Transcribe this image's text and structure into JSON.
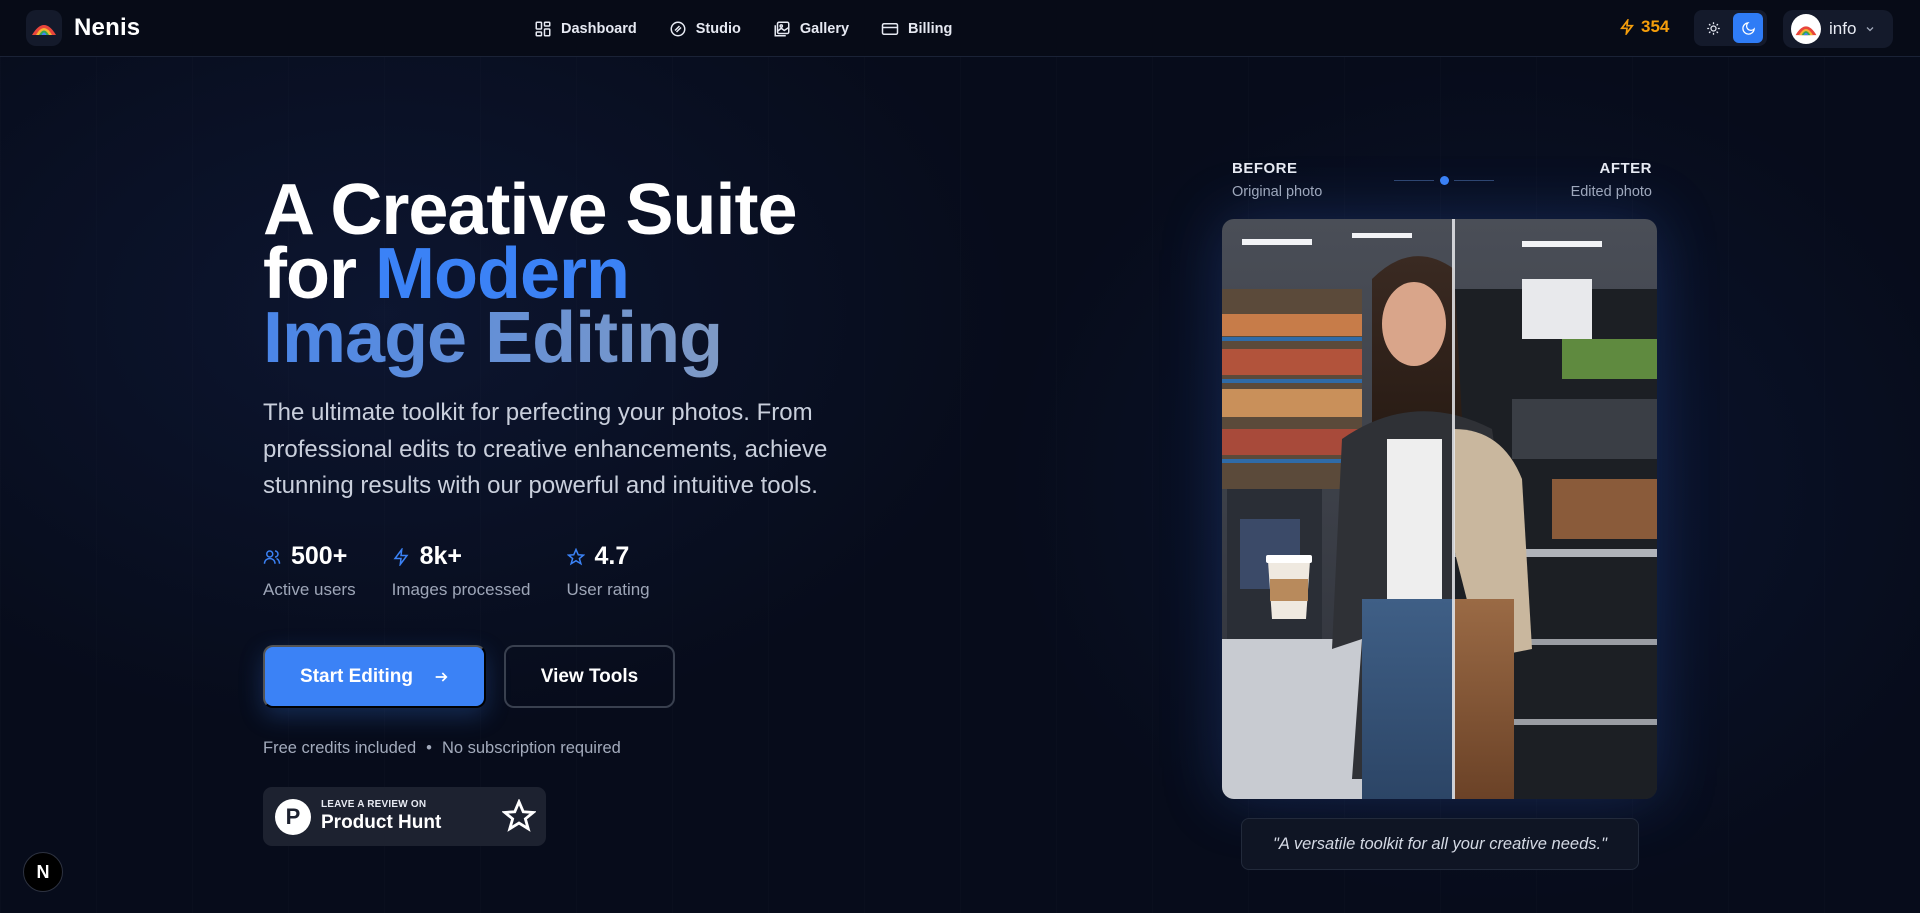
{
  "app": {
    "name": "Nenis"
  },
  "nav": {
    "items": [
      {
        "label": "Dashboard",
        "icon": "dashboard-icon"
      },
      {
        "label": "Studio",
        "icon": "studio-icon"
      },
      {
        "label": "Gallery",
        "icon": "gallery-icon"
      },
      {
        "label": "Billing",
        "icon": "billing-icon"
      }
    ]
  },
  "header": {
    "credits": "354",
    "credits_icon": "lightning-icon",
    "user_name": "info",
    "theme": {
      "light_icon": "sun-icon",
      "dark_icon": "moon-icon",
      "active": "dark"
    }
  },
  "hero": {
    "title_line1": "A Creative Suite",
    "title_for": "for",
    "title_modern": "Modern",
    "title_line3": "Image Editing",
    "subtitle": "The ultimate toolkit for perfecting your photos. From professional edits to creative enhancements, achieve stunning results with our powerful and intuitive tools.",
    "stats": [
      {
        "value": "500+",
        "label": "Active users",
        "icon": "users-icon"
      },
      {
        "value": "8k+",
        "label": "Images processed",
        "icon": "lightning-icon"
      },
      {
        "value": "4.7",
        "label": "User rating",
        "icon": "star-icon"
      }
    ],
    "primary_cta": "Start Editing",
    "secondary_cta": "View Tools",
    "note_left": "Free credits included",
    "note_sep": "•",
    "note_right": "No subscription required",
    "product_hunt": {
      "small": "LEAVE A REVIEW ON",
      "big": "Product Hunt",
      "logo": "P"
    }
  },
  "compare": {
    "before_title": "BEFORE",
    "before_sub": "Original photo",
    "after_title": "AFTER",
    "after_sub": "Edited photo",
    "quote": "\"A versatile toolkit for all your creative needs.\""
  },
  "next_badge": "N",
  "colors": {
    "accent": "#3b82f6",
    "credits": "#f59e0b",
    "background": "#070c1b"
  }
}
